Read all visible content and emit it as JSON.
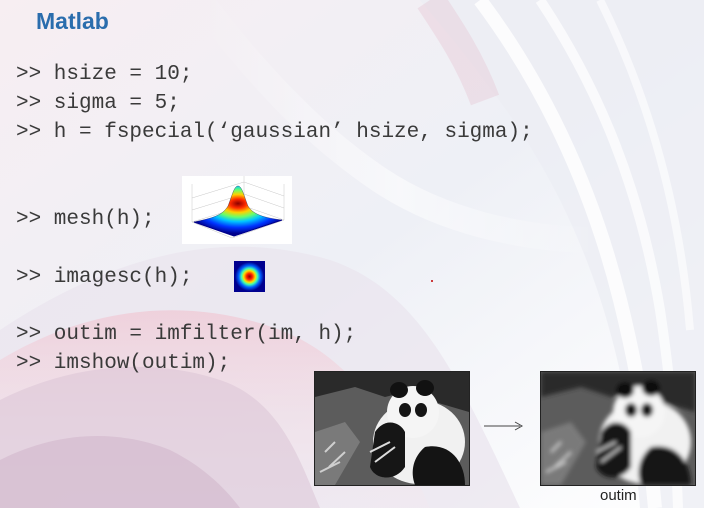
{
  "slide": {
    "title": "Matlab",
    "code_lines": [
      ">> hsize = 10;",
      ">> sigma = 5;",
      ">> h = fspecial(‘gaussian’ hsize, sigma);",
      ">> mesh(h);",
      ">> imagesc(h);",
      ">> outim = imfilter(im, h);",
      ">> imshow(outim);"
    ],
    "output_caption": "outim"
  },
  "figures": {
    "mesh_plot": "gaussian-mesh-surface",
    "imagesc_plot": "gaussian-heatmap",
    "input_image": "panda-photo",
    "output_image": "blurred-panda-photo",
    "arrow_icon": "right-arrow-icon"
  }
}
